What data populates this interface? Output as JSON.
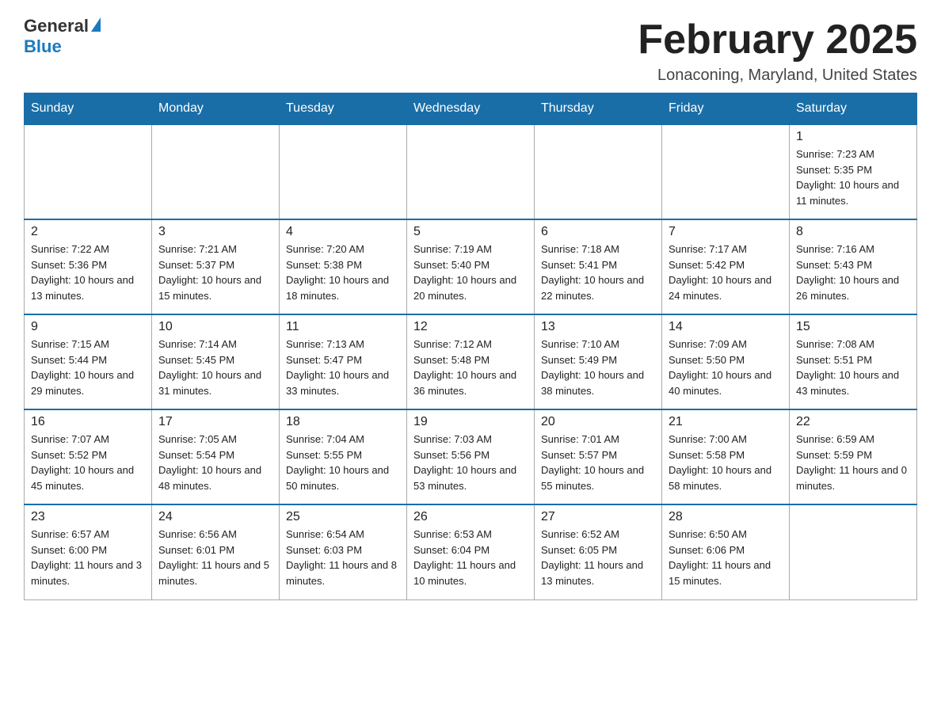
{
  "header": {
    "logo_general": "General",
    "logo_blue": "Blue",
    "title": "February 2025",
    "subtitle": "Lonaconing, Maryland, United States"
  },
  "days_of_week": [
    "Sunday",
    "Monday",
    "Tuesday",
    "Wednesday",
    "Thursday",
    "Friday",
    "Saturday"
  ],
  "weeks": [
    [
      {
        "day": "",
        "sunrise": "",
        "sunset": "",
        "daylight": ""
      },
      {
        "day": "",
        "sunrise": "",
        "sunset": "",
        "daylight": ""
      },
      {
        "day": "",
        "sunrise": "",
        "sunset": "",
        "daylight": ""
      },
      {
        "day": "",
        "sunrise": "",
        "sunset": "",
        "daylight": ""
      },
      {
        "day": "",
        "sunrise": "",
        "sunset": "",
        "daylight": ""
      },
      {
        "day": "",
        "sunrise": "",
        "sunset": "",
        "daylight": ""
      },
      {
        "day": "1",
        "sunrise": "Sunrise: 7:23 AM",
        "sunset": "Sunset: 5:35 PM",
        "daylight": "Daylight: 10 hours and 11 minutes."
      }
    ],
    [
      {
        "day": "2",
        "sunrise": "Sunrise: 7:22 AM",
        "sunset": "Sunset: 5:36 PM",
        "daylight": "Daylight: 10 hours and 13 minutes."
      },
      {
        "day": "3",
        "sunrise": "Sunrise: 7:21 AM",
        "sunset": "Sunset: 5:37 PM",
        "daylight": "Daylight: 10 hours and 15 minutes."
      },
      {
        "day": "4",
        "sunrise": "Sunrise: 7:20 AM",
        "sunset": "Sunset: 5:38 PM",
        "daylight": "Daylight: 10 hours and 18 minutes."
      },
      {
        "day": "5",
        "sunrise": "Sunrise: 7:19 AM",
        "sunset": "Sunset: 5:40 PM",
        "daylight": "Daylight: 10 hours and 20 minutes."
      },
      {
        "day": "6",
        "sunrise": "Sunrise: 7:18 AM",
        "sunset": "Sunset: 5:41 PM",
        "daylight": "Daylight: 10 hours and 22 minutes."
      },
      {
        "day": "7",
        "sunrise": "Sunrise: 7:17 AM",
        "sunset": "Sunset: 5:42 PM",
        "daylight": "Daylight: 10 hours and 24 minutes."
      },
      {
        "day": "8",
        "sunrise": "Sunrise: 7:16 AM",
        "sunset": "Sunset: 5:43 PM",
        "daylight": "Daylight: 10 hours and 26 minutes."
      }
    ],
    [
      {
        "day": "9",
        "sunrise": "Sunrise: 7:15 AM",
        "sunset": "Sunset: 5:44 PM",
        "daylight": "Daylight: 10 hours and 29 minutes."
      },
      {
        "day": "10",
        "sunrise": "Sunrise: 7:14 AM",
        "sunset": "Sunset: 5:45 PM",
        "daylight": "Daylight: 10 hours and 31 minutes."
      },
      {
        "day": "11",
        "sunrise": "Sunrise: 7:13 AM",
        "sunset": "Sunset: 5:47 PM",
        "daylight": "Daylight: 10 hours and 33 minutes."
      },
      {
        "day": "12",
        "sunrise": "Sunrise: 7:12 AM",
        "sunset": "Sunset: 5:48 PM",
        "daylight": "Daylight: 10 hours and 36 minutes."
      },
      {
        "day": "13",
        "sunrise": "Sunrise: 7:10 AM",
        "sunset": "Sunset: 5:49 PM",
        "daylight": "Daylight: 10 hours and 38 minutes."
      },
      {
        "day": "14",
        "sunrise": "Sunrise: 7:09 AM",
        "sunset": "Sunset: 5:50 PM",
        "daylight": "Daylight: 10 hours and 40 minutes."
      },
      {
        "day": "15",
        "sunrise": "Sunrise: 7:08 AM",
        "sunset": "Sunset: 5:51 PM",
        "daylight": "Daylight: 10 hours and 43 minutes."
      }
    ],
    [
      {
        "day": "16",
        "sunrise": "Sunrise: 7:07 AM",
        "sunset": "Sunset: 5:52 PM",
        "daylight": "Daylight: 10 hours and 45 minutes."
      },
      {
        "day": "17",
        "sunrise": "Sunrise: 7:05 AM",
        "sunset": "Sunset: 5:54 PM",
        "daylight": "Daylight: 10 hours and 48 minutes."
      },
      {
        "day": "18",
        "sunrise": "Sunrise: 7:04 AM",
        "sunset": "Sunset: 5:55 PM",
        "daylight": "Daylight: 10 hours and 50 minutes."
      },
      {
        "day": "19",
        "sunrise": "Sunrise: 7:03 AM",
        "sunset": "Sunset: 5:56 PM",
        "daylight": "Daylight: 10 hours and 53 minutes."
      },
      {
        "day": "20",
        "sunrise": "Sunrise: 7:01 AM",
        "sunset": "Sunset: 5:57 PM",
        "daylight": "Daylight: 10 hours and 55 minutes."
      },
      {
        "day": "21",
        "sunrise": "Sunrise: 7:00 AM",
        "sunset": "Sunset: 5:58 PM",
        "daylight": "Daylight: 10 hours and 58 minutes."
      },
      {
        "day": "22",
        "sunrise": "Sunrise: 6:59 AM",
        "sunset": "Sunset: 5:59 PM",
        "daylight": "Daylight: 11 hours and 0 minutes."
      }
    ],
    [
      {
        "day": "23",
        "sunrise": "Sunrise: 6:57 AM",
        "sunset": "Sunset: 6:00 PM",
        "daylight": "Daylight: 11 hours and 3 minutes."
      },
      {
        "day": "24",
        "sunrise": "Sunrise: 6:56 AM",
        "sunset": "Sunset: 6:01 PM",
        "daylight": "Daylight: 11 hours and 5 minutes."
      },
      {
        "day": "25",
        "sunrise": "Sunrise: 6:54 AM",
        "sunset": "Sunset: 6:03 PM",
        "daylight": "Daylight: 11 hours and 8 minutes."
      },
      {
        "day": "26",
        "sunrise": "Sunrise: 6:53 AM",
        "sunset": "Sunset: 6:04 PM",
        "daylight": "Daylight: 11 hours and 10 minutes."
      },
      {
        "day": "27",
        "sunrise": "Sunrise: 6:52 AM",
        "sunset": "Sunset: 6:05 PM",
        "daylight": "Daylight: 11 hours and 13 minutes."
      },
      {
        "day": "28",
        "sunrise": "Sunrise: 6:50 AM",
        "sunset": "Sunset: 6:06 PM",
        "daylight": "Daylight: 11 hours and 15 minutes."
      },
      {
        "day": "",
        "sunrise": "",
        "sunset": "",
        "daylight": ""
      }
    ]
  ]
}
